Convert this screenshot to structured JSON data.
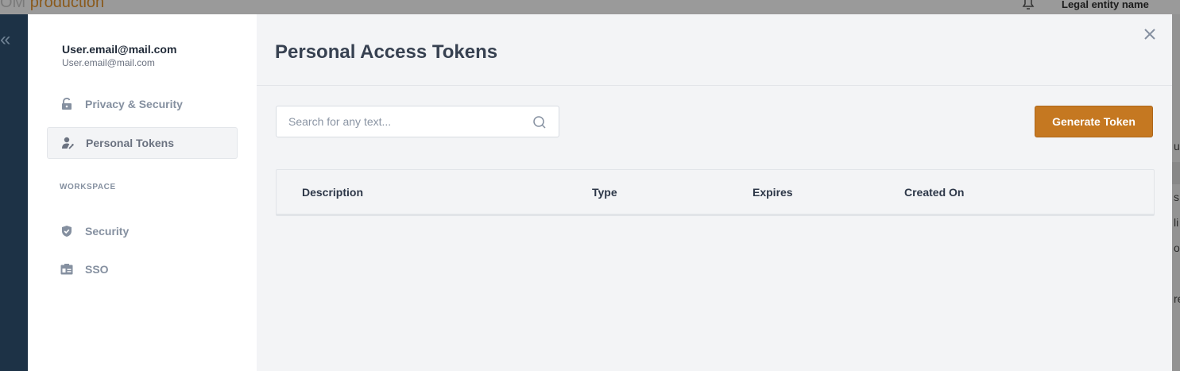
{
  "background": {
    "brand_prefix": "OM",
    "brand_env": "production",
    "entity_name": "Legal entity name",
    "collapse_glyph": "«",
    "right_fragments": [
      "ue",
      "s",
      "li",
      "ob",
      "re"
    ]
  },
  "sidebar": {
    "user_name": "User.email@mail.com",
    "user_email": "User.email@mail.com",
    "items": [
      {
        "label": "Privacy & Security",
        "icon": "lock-icon"
      },
      {
        "label": "Personal Tokens",
        "icon": "user-key-icon",
        "active": true
      }
    ],
    "workspace_label": "WORKSPACE",
    "workspace_items": [
      {
        "label": "Security",
        "icon": "shield-icon"
      },
      {
        "label": "SSO",
        "icon": "id-card-icon"
      }
    ]
  },
  "main": {
    "title": "Personal Access Tokens",
    "search_placeholder": "Search for any text...",
    "generate_button": "Generate Token",
    "columns": [
      "Description",
      "Type",
      "Expires",
      "Created On"
    ]
  },
  "colors": {
    "accent": "#c57821",
    "sidebar_active": "#f3f4f6",
    "nav_bg": "#1d3246"
  }
}
